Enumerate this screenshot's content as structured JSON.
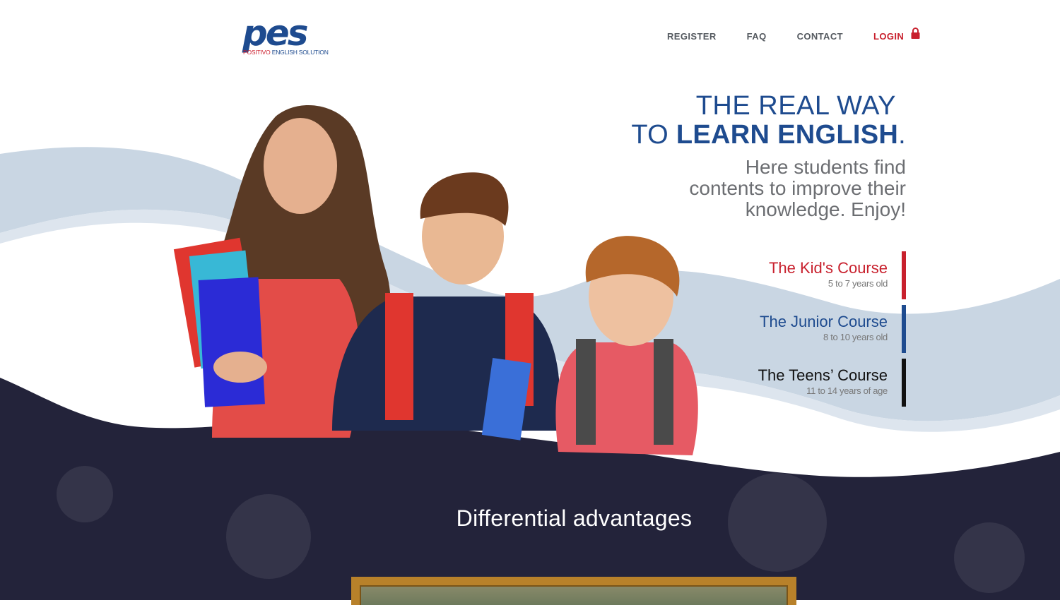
{
  "brand": {
    "logo_mark": "pes",
    "logo_sub_red": "POSITIVO",
    "logo_sub_blue": "ENGLISH SOLUTION",
    "primary_color": "#1e4b8f",
    "accent_color": "#c8202d"
  },
  "nav": {
    "register": "REGISTER",
    "faq": "FAQ",
    "contact": "CONTACT",
    "login": "LOGIN",
    "login_icon": "lock-icon"
  },
  "hero": {
    "line1": "THE REAL WAY",
    "line2_prefix": "TO",
    "line2_bold": "LEARN ENGLISH",
    "line2_suffix": ".",
    "subtitle": "Here students find contents to improve their knowledge. Enjoy!"
  },
  "courses": [
    {
      "title": "The Kid's Course",
      "age": "5 to 7 years old",
      "color": "#c8202d"
    },
    {
      "title": "The Junior Course",
      "age": "8 to 10 years old",
      "color": "#1e4b8f"
    },
    {
      "title": "The Teens’ Course",
      "age": "11 to 14 years of age",
      "color": "#111111"
    }
  ],
  "section": {
    "title": "Differential advantages"
  },
  "colors": {
    "chalkboard": "#23233a",
    "wave": "#c9d6e3",
    "wave_light": "#dde5ee"
  }
}
